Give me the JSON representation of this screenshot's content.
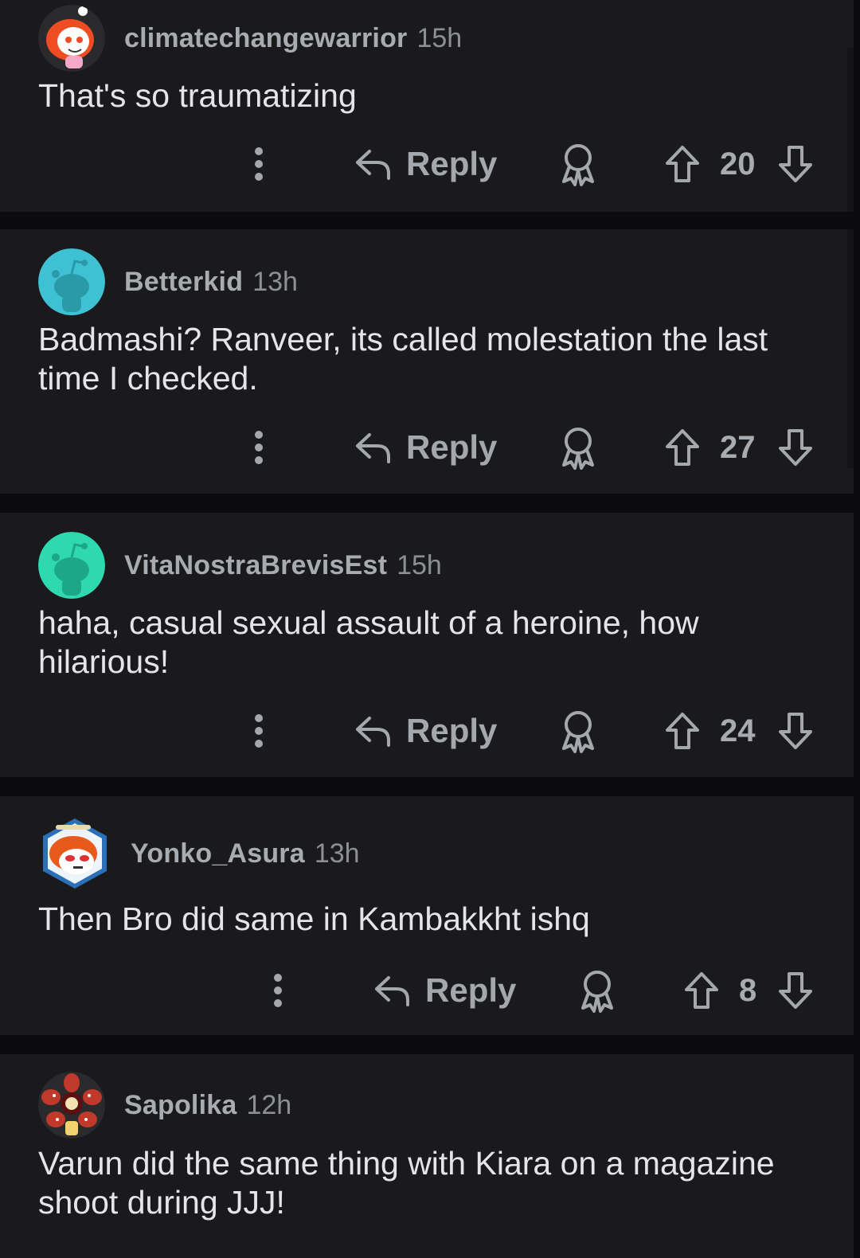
{
  "comments": [
    {
      "username": "climatechangewarrior",
      "time": "15h",
      "text": "That's so traumatizing",
      "reply_label": "Reply",
      "votes": "20",
      "avatar_icon": "snoo-redhead-avatar",
      "avatar_color": "#f04c24"
    },
    {
      "username": "Betterkid",
      "time": "13h",
      "text": "Badmashi? Ranveer, its called molestation the last time I checked.",
      "reply_label": "Reply",
      "votes": "27",
      "avatar_icon": "snoo-default-avatar",
      "avatar_color": "#3ec1d3"
    },
    {
      "username": "VitaNostraBrevisEst",
      "time": "15h",
      "text": "haha, casual sexual assault of a heroine, how hilarious!",
      "reply_label": "Reply",
      "votes": "24",
      "avatar_icon": "snoo-default-avatar",
      "avatar_color": "#2ed9b0"
    },
    {
      "username": "Yonko_Asura",
      "time": "13h",
      "text": "Then Bro did same in Kambakkht ishq",
      "reply_label": "Reply",
      "votes": "8",
      "avatar_icon": "snoo-hexagon-nft-avatar",
      "avatar_color": "#2a6fb8"
    },
    {
      "username": "Sapolika",
      "time": "12h",
      "text": "Varun did the same thing with Kiara on a magazine shoot during JJJ!",
      "reply_label": "Reply",
      "votes": "",
      "avatar_icon": "snoo-demogorgon-avatar",
      "avatar_color": "#c0392b"
    }
  ],
  "icons": {
    "more": "more-vertical-icon",
    "reply": "reply-arrow-icon",
    "award": "award-icon",
    "upvote": "upvote-arrow-icon",
    "downvote": "downvote-arrow-icon"
  },
  "colors": {
    "background": "#0b0b0d",
    "card": "#1a1a1c",
    "username": "#a8acb0",
    "text": "#e3e5e7"
  }
}
